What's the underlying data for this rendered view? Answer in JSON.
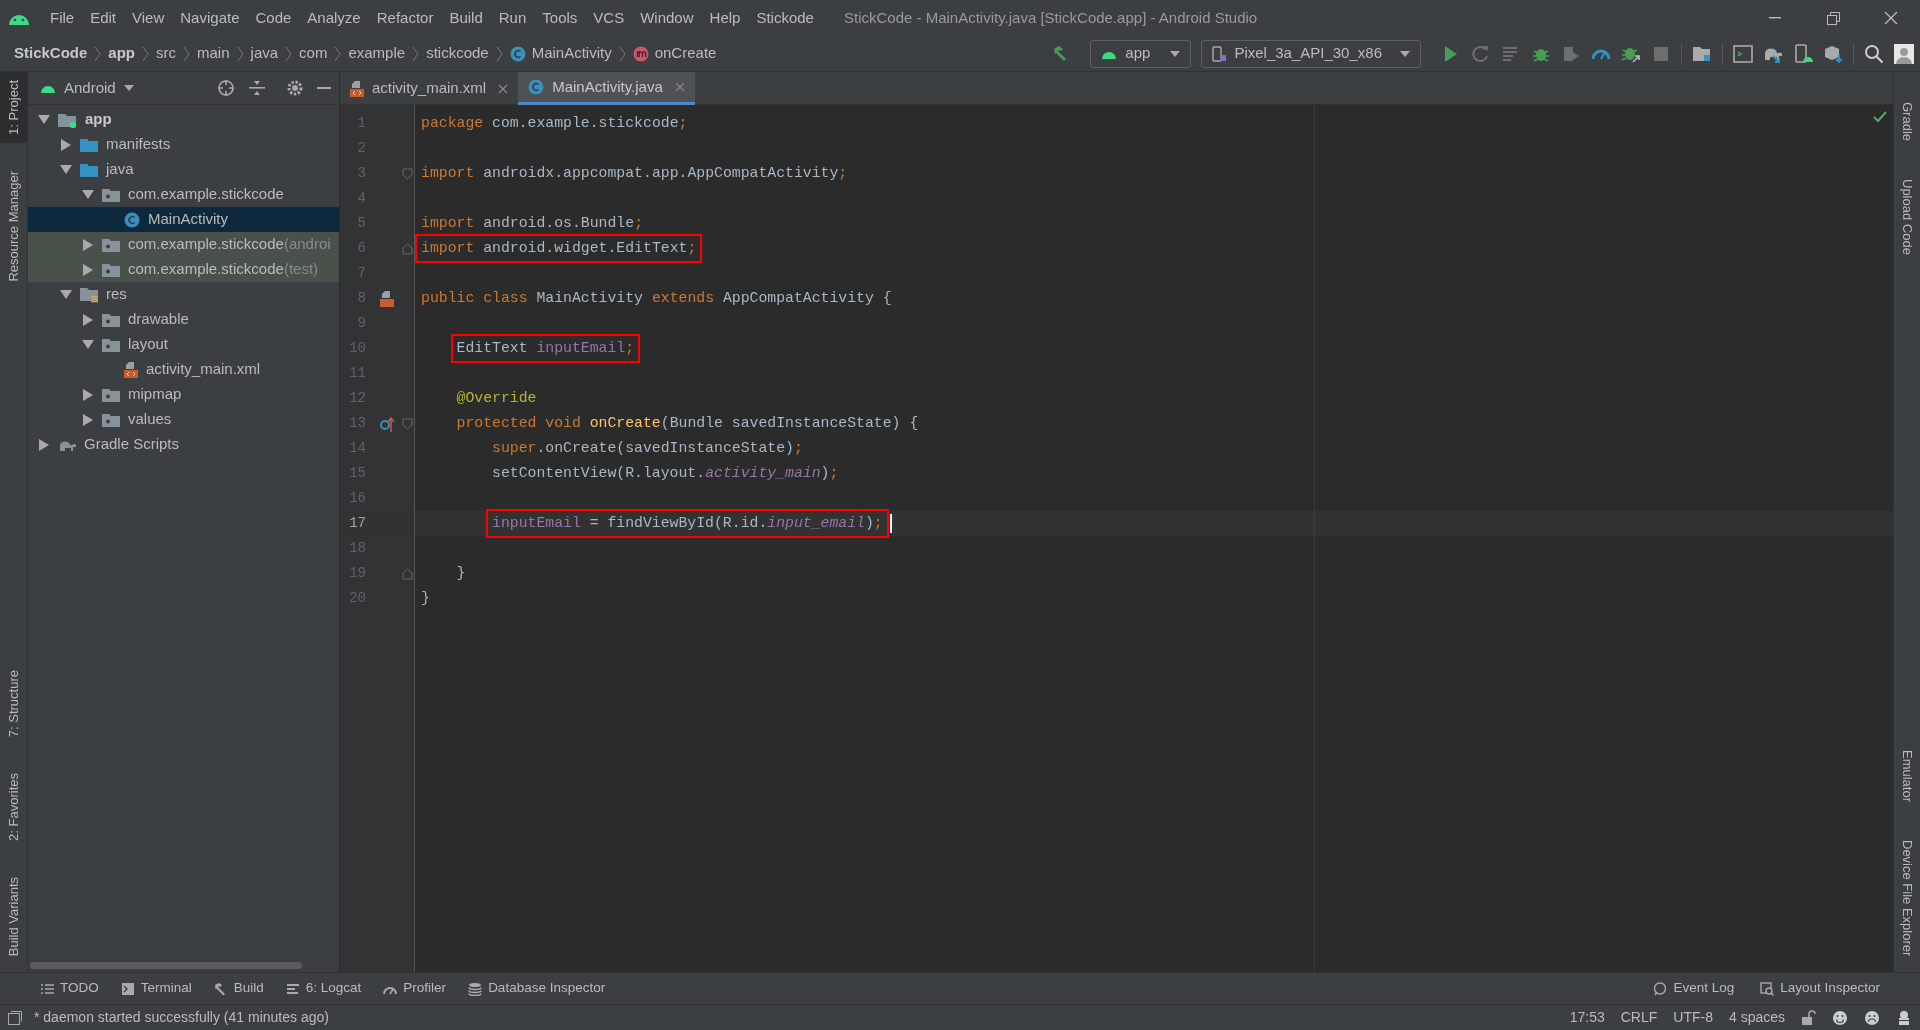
{
  "menu": [
    "File",
    "Edit",
    "View",
    "Navigate",
    "Code",
    "Analyze",
    "Refactor",
    "Build",
    "Run",
    "Tools",
    "VCS",
    "Window",
    "Help",
    "Stickode"
  ],
  "window": {
    "title": "StickCode - MainActivity.java [StickCode.app] - Android Studio"
  },
  "breadcrumbs": [
    {
      "label": "StickCode",
      "kind": "project"
    },
    {
      "label": "app",
      "kind": "module"
    },
    {
      "label": "src",
      "kind": "dir"
    },
    {
      "label": "main",
      "kind": "dir"
    },
    {
      "label": "java",
      "kind": "dir"
    },
    {
      "label": "com",
      "kind": "dir"
    },
    {
      "label": "example",
      "kind": "dir"
    },
    {
      "label": "stickcode",
      "kind": "dir"
    },
    {
      "label": "MainActivity",
      "kind": "class"
    },
    {
      "label": "onCreate",
      "kind": "method"
    }
  ],
  "toolbar": {
    "run_config": "app",
    "device": "Pixel_3a_API_30_x86"
  },
  "left_strip": {
    "top": [
      {
        "label": "1: Project",
        "selected": true
      },
      {
        "label": "Resource Manager",
        "selected": false
      }
    ],
    "bottom": [
      {
        "label": "7: Structure",
        "selected": false
      },
      {
        "label": "2: Favorites",
        "selected": false
      },
      {
        "label": "Build Variants",
        "selected": false
      }
    ]
  },
  "right_strip": {
    "top": [
      "Gradle",
      "Upload Code"
    ],
    "bottom": [
      "Emulator",
      "Device File Explorer"
    ]
  },
  "project": {
    "view": "Android",
    "tree": [
      {
        "label": "app",
        "kind": "module",
        "expanded": true,
        "selected": false,
        "children": [
          {
            "label": "manifests",
            "kind": "folder",
            "expanded": false,
            "selected": false
          },
          {
            "label": "java",
            "kind": "folder",
            "expanded": true,
            "selected": false,
            "children": [
              {
                "label": "com.example.stickcode",
                "kind": "package",
                "expanded": true,
                "selected": false,
                "children": [
                  {
                    "label": "MainActivity",
                    "kind": "class",
                    "selected": true
                  }
                ]
              },
              {
                "label": "com.example.stickcode",
                "suffix": "(androi",
                "kind": "package",
                "tinted": true,
                "expanded": false,
                "selected": false
              },
              {
                "label": "com.example.stickcode",
                "suffix": "(test)",
                "kind": "package",
                "tinted": true,
                "expanded": false,
                "selected": false
              }
            ]
          },
          {
            "label": "res",
            "kind": "res",
            "expanded": true,
            "selected": false,
            "children": [
              {
                "label": "drawable",
                "kind": "package",
                "expanded": false,
                "selected": false
              },
              {
                "label": "layout",
                "kind": "package",
                "expanded": true,
                "selected": false,
                "children": [
                  {
                    "label": "activity_main.xml",
                    "kind": "xml",
                    "selected": false
                  }
                ]
              },
              {
                "label": "mipmap",
                "kind": "package",
                "expanded": false,
                "selected": false
              },
              {
                "label": "values",
                "kind": "package",
                "expanded": false,
                "selected": false
              }
            ]
          }
        ]
      },
      {
        "label": "Gradle Scripts",
        "kind": "gradle",
        "expanded": false,
        "selected": false
      }
    ]
  },
  "tabs": [
    {
      "label": "activity_main.xml",
      "kind": "xml",
      "selected": false
    },
    {
      "label": "MainActivity.java",
      "kind": "class",
      "selected": true
    }
  ],
  "lines": [
    {
      "number": "1",
      "current": false,
      "boxed": false,
      "tokens": [
        {
          "t": "package ",
          "kind": "keyword"
        },
        {
          "t": "com.example.stickcode",
          "kind": "plain"
        },
        {
          "t": ";",
          "kind": "keyword"
        }
      ]
    },
    {
      "number": "2",
      "current": false
    },
    {
      "number": "3",
      "current": false,
      "boxed": false,
      "markers": [
        {
          "kind": "fold_open"
        }
      ],
      "tokens": [
        {
          "t": "import ",
          "kind": "keyword"
        },
        {
          "t": "androidx.appcompat.app.AppCompatActivity",
          "kind": "plain"
        },
        {
          "t": ";",
          "kind": "keyword"
        }
      ]
    },
    {
      "number": "4",
      "current": false
    },
    {
      "number": "5",
      "current": false,
      "boxed": false,
      "tokens": [
        {
          "t": "import ",
          "kind": "keyword"
        },
        {
          "t": "android.os.Bundle",
          "kind": "plain"
        },
        {
          "t": ";",
          "kind": "keyword"
        }
      ]
    },
    {
      "number": "6",
      "current": false,
      "boxed": true,
      "markers": [
        {
          "kind": "fold_close"
        }
      ],
      "tokens": [
        {
          "t": "import ",
          "kind": "keyword"
        },
        {
          "t": "android.widget.EditText",
          "kind": "plain"
        },
        {
          "t": ";",
          "kind": "keyword"
        }
      ]
    },
    {
      "number": "7",
      "current": false
    },
    {
      "number": "8",
      "current": false,
      "boxed": false,
      "markers": [
        {
          "kind": "layout"
        }
      ],
      "tokens": [
        {
          "t": "public class ",
          "kind": "keyword"
        },
        {
          "t": "MainActivity ",
          "kind": "plain"
        },
        {
          "t": "extends ",
          "kind": "keyword"
        },
        {
          "t": "AppCompatActivity {",
          "kind": "plain"
        }
      ],
      "children": [
        {
          "number": "9",
          "current": false
        },
        {
          "number": "10",
          "current": false,
          "boxed": true,
          "tokens": [
            {
              "t": "EditText ",
              "kind": "plain"
            },
            {
              "t": "inputEmail",
              "kind": "field"
            },
            {
              "t": ";",
              "kind": "keyword"
            }
          ]
        },
        {
          "number": "11",
          "current": false
        },
        {
          "number": "12",
          "current": false,
          "boxed": false,
          "tokens": [
            {
              "t": "@Override",
              "kind": "annotation"
            }
          ]
        },
        {
          "number": "13",
          "current": false,
          "boxed": false,
          "markers": [
            {
              "kind": "override"
            },
            {
              "kind": "fold_open"
            }
          ],
          "tokens": [
            {
              "t": "protected void ",
              "kind": "keyword"
            },
            {
              "t": "onCreate",
              "kind": "method"
            },
            {
              "t": "(Bundle savedInstanceState) {",
              "kind": "plain"
            }
          ],
          "children": [
            {
              "number": "14",
              "current": false,
              "boxed": false,
              "tokens": [
                {
                  "t": "super",
                  "kind": "keyword"
                },
                {
                  "t": ".onCreate(savedInstanceState)",
                  "kind": "plain"
                },
                {
                  "t": ";",
                  "kind": "keyword"
                }
              ]
            },
            {
              "number": "15",
              "current": false,
              "boxed": false,
              "tokens": [
                {
                  "t": "setContentView(R.layout.",
                  "kind": "plain"
                },
                {
                  "t": "activity_main",
                  "kind": "static"
                },
                {
                  "t": ")",
                  "kind": "plain"
                },
                {
                  "t": ";",
                  "kind": "keyword"
                }
              ]
            },
            {
              "number": "16",
              "current": false
            },
            {
              "number": "17",
              "current": true,
              "boxed": true,
              "tokens": [
                {
                  "t": "inputEmail",
                  "kind": "field"
                },
                {
                  "t": " = findViewById(R.id.",
                  "kind": "plain"
                },
                {
                  "t": "input_email",
                  "kind": "static"
                },
                {
                  "t": ")",
                  "kind": "plain"
                },
                {
                  "t": ";",
                  "kind": "keyword"
                }
              ]
            },
            {
              "number": "18",
              "current": false
            }
          ]
        },
        {
          "number": "19",
          "current": false,
          "boxed": false,
          "markers": [
            {
              "kind": "fold_close"
            }
          ],
          "tokens": [
            {
              "t": "}",
              "kind": "plain"
            }
          ]
        }
      ]
    },
    {
      "number": "20",
      "current": false,
      "boxed": false,
      "tokens": [
        {
          "t": "}",
          "kind": "plain"
        }
      ]
    }
  ],
  "tool_windows": {
    "left": [
      {
        "label": "TODO",
        "kind": "list"
      },
      {
        "label": "Terminal",
        "kind": "terminal"
      },
      {
        "label": "Build",
        "kind": "hammer"
      },
      {
        "label": "6: Logcat",
        "kind": "logcat"
      },
      {
        "label": "Profiler",
        "kind": "gauge"
      },
      {
        "label": "Database Inspector",
        "kind": "db"
      }
    ],
    "right": [
      {
        "label": "Event Log",
        "kind": "bubble"
      },
      {
        "label": "Layout Inspector",
        "kind": "inspect"
      }
    ]
  },
  "status_bar": {
    "message": "* daemon started successfully (41 minutes ago)",
    "items": [
      "17:53",
      "CRLF",
      "UTF-8",
      "4 spaces"
    ]
  }
}
